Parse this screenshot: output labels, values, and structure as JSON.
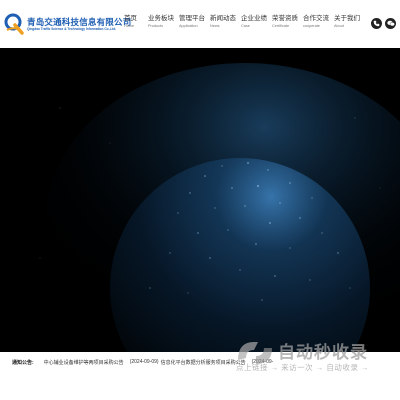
{
  "logo": {
    "name_cn": "青岛交通科技信息有限公司",
    "name_en": "Qingdao Traffic Science & Technology Information Co.,Ltd."
  },
  "nav": [
    {
      "cn": "首页",
      "en": "Home"
    },
    {
      "cn": "业务板块",
      "en": "Products"
    },
    {
      "cn": "管理平台",
      "en": "Application"
    },
    {
      "cn": "新闻动态",
      "en": "News"
    },
    {
      "cn": "企业业绩",
      "en": "Case"
    },
    {
      "cn": "荣誉资质",
      "en": "Certificate"
    },
    {
      "cn": "合作交流",
      "en": "cooperate"
    },
    {
      "cn": "关于我们",
      "en": "About"
    }
  ],
  "header_icons": [
    "phone-icon",
    "wechat-icon"
  ],
  "notice": {
    "label": "通知公告:",
    "items": [
      {
        "title": "中心辅业设备维护等两项目采购公告",
        "date": ""
      },
      {
        "title": "信息化平台数据分析服务项目采购公告",
        "date": "(2024-09-09)"
      },
      {
        "title": "",
        "date": "(2024-09-"
      }
    ]
  },
  "watermark": {
    "title": "自动秒收录",
    "subtitle": "点上链接 → 来访一次 → 自动收录 →"
  },
  "colors": {
    "brand_blue": "#1f5fb3",
    "logo_orange": "#f0a020",
    "hero_bg": "#000000",
    "globe_glow": "#2a6aa0"
  }
}
